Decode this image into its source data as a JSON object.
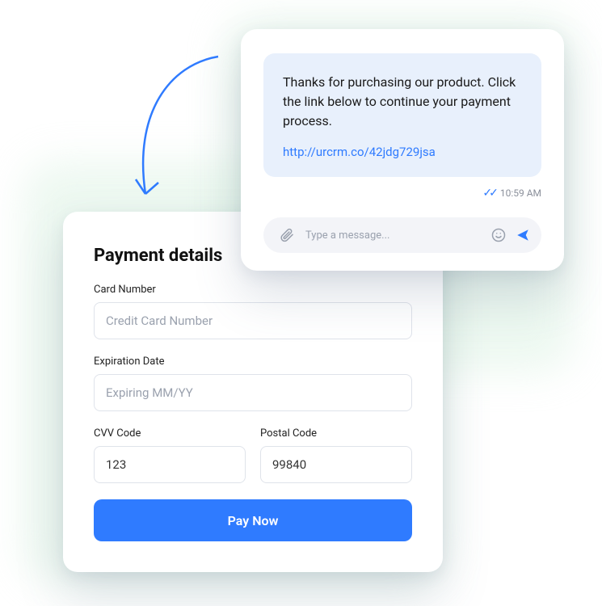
{
  "payment": {
    "title": "Payment details",
    "card_number_label": "Card Number",
    "card_number_placeholder": "Credit Card Number",
    "expiration_label": "Expiration Date",
    "expiration_placeholder": "Expiring MM/YY",
    "cvv_label": "CVV Code",
    "cvv_value": "123",
    "postal_label": "Postal Code",
    "postal_value": "99840",
    "pay_button_label": "Pay Now"
  },
  "chat": {
    "message_text": "Thanks for purchasing our product. Click the link below to continue your payment process.",
    "message_link": "http://urcrm.co/42jdg729jsa",
    "timestamp": "10:59 AM",
    "composer_placeholder": "Type a message..."
  }
}
